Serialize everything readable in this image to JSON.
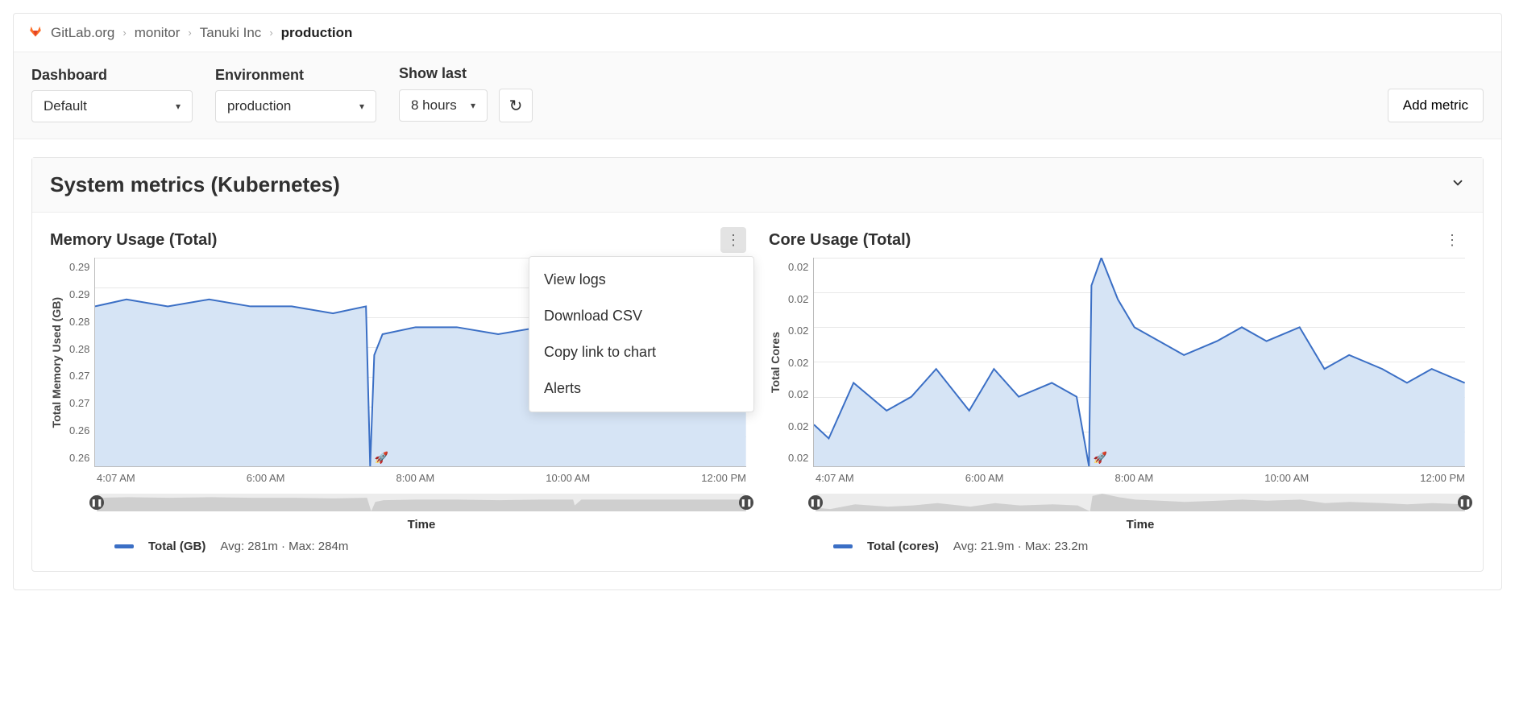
{
  "breadcrumbs": {
    "items": [
      "GitLab.org",
      "monitor",
      "Tanuki Inc",
      "production"
    ]
  },
  "toolbar": {
    "dashboard_label": "Dashboard",
    "dashboard_value": "Default",
    "environment_label": "Environment",
    "environment_value": "production",
    "showlast_label": "Show last",
    "showlast_value": "8 hours",
    "add_metric_label": "Add metric"
  },
  "panel": {
    "title": "System metrics (Kubernetes)"
  },
  "dropdown": {
    "items": [
      "View logs",
      "Download CSV",
      "Copy link to chart",
      "Alerts"
    ]
  },
  "charts": [
    {
      "title": "Memory Usage (Total)",
      "ylabel": "Total Memory Used (GB)",
      "xlabel": "Time",
      "legend_name": "Total (GB)",
      "legend_stats": "Avg: 281m · Max: 284m",
      "menu_open": true
    },
    {
      "title": "Core Usage (Total)",
      "ylabel": "Total Cores",
      "xlabel": "Time",
      "legend_name": "Total (cores)",
      "legend_stats": "Avg: 21.9m · Max: 23.2m",
      "menu_open": false
    }
  ],
  "chart_data": [
    {
      "type": "area",
      "title": "Memory Usage (Total)",
      "xlabel": "Time",
      "ylabel": "Total Memory Used (GB)",
      "ylim": [
        0.26,
        0.29
      ],
      "x_ticks": [
        "4:07 AM",
        "6:00 AM",
        "8:00 AM",
        "10:00 AM",
        "12:00 PM"
      ],
      "y_ticks": [
        "0.29",
        "0.29",
        "0.28",
        "0.28",
        "0.27",
        "0.27",
        "0.26",
        "0.26"
      ],
      "series": [
        {
          "name": "Total (GB)",
          "x": [
            4.12,
            4.5,
            5.0,
            5.5,
            6.0,
            6.5,
            7.0,
            7.4,
            7.45,
            7.5,
            7.6,
            8.0,
            8.5,
            9.0,
            9.5,
            9.9,
            9.92,
            10.0,
            10.5,
            11.0,
            11.5,
            12.0
          ],
          "values": [
            0.283,
            0.284,
            0.283,
            0.284,
            0.283,
            0.283,
            0.282,
            0.283,
            0.26,
            0.276,
            0.279,
            0.28,
            0.28,
            0.279,
            0.28,
            0.28,
            0.27,
            0.28,
            0.28,
            0.28,
            0.28,
            0.28
          ]
        }
      ],
      "deploy_markers_x": [
        7.5
      ]
    },
    {
      "type": "area",
      "title": "Core Usage (Total)",
      "xlabel": "Time",
      "ylabel": "Total Cores",
      "ylim": [
        0.015,
        0.03
      ],
      "x_ticks": [
        "4:07 AM",
        "6:00 AM",
        "8:00 AM",
        "10:00 AM",
        "12:00 PM"
      ],
      "y_ticks": [
        "0.02",
        "0.02",
        "0.02",
        "0.02",
        "0.02",
        "0.02",
        "0.02"
      ],
      "series": [
        {
          "name": "Total (cores)",
          "x": [
            4.12,
            4.3,
            4.6,
            5.0,
            5.3,
            5.6,
            6.0,
            6.3,
            6.6,
            7.0,
            7.3,
            7.45,
            7.48,
            7.6,
            7.8,
            8.0,
            8.3,
            8.6,
            9.0,
            9.3,
            9.6,
            10.0,
            10.3,
            10.6,
            11.0,
            11.3,
            11.6,
            12.0
          ],
          "values": [
            0.018,
            0.017,
            0.021,
            0.019,
            0.02,
            0.022,
            0.019,
            0.022,
            0.02,
            0.021,
            0.02,
            0.015,
            0.028,
            0.03,
            0.027,
            0.025,
            0.024,
            0.023,
            0.024,
            0.025,
            0.024,
            0.025,
            0.022,
            0.023,
            0.022,
            0.021,
            0.022,
            0.021
          ]
        }
      ],
      "deploy_markers_x": [
        7.5
      ]
    }
  ]
}
